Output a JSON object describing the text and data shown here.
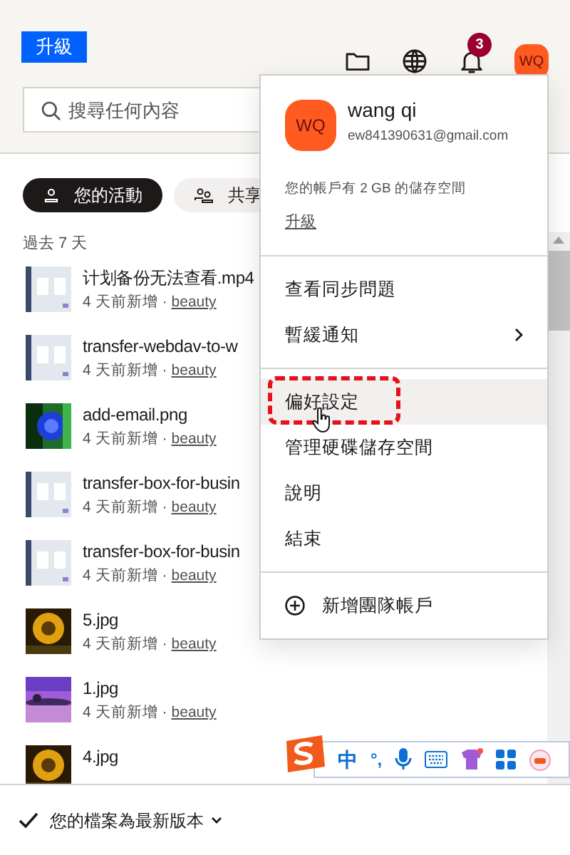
{
  "header": {
    "upgrade_button": "升級",
    "search": {
      "placeholder": "搜尋任何內容"
    },
    "notification_count": "3",
    "avatar": "WQ"
  },
  "filters": [
    {
      "label": "您的活動",
      "selected": true
    },
    {
      "label": "共享",
      "selected": false
    }
  ],
  "section_title": "過去 7 天",
  "files": [
    {
      "name": "计划备份无法查看.mp4",
      "added": "4 天前新增",
      "separator": "·",
      "owner": "beauty"
    },
    {
      "name": "transfer-webdav-to-w",
      "added": "4 天前新增",
      "separator": "·",
      "owner": "beauty"
    },
    {
      "name": "add-email.png",
      "added": "4 天前新增",
      "separator": "·",
      "owner": "beauty"
    },
    {
      "name": "transfer-box-for-busin",
      "added": "4 天前新增",
      "separator": "·",
      "owner": "beauty"
    },
    {
      "name": "transfer-box-for-busin",
      "added": "4 天前新增",
      "separator": "·",
      "owner": "beauty"
    },
    {
      "name": "5.jpg",
      "added": "4 天前新增",
      "separator": "·",
      "owner": "beauty"
    },
    {
      "name": "1.jpg",
      "added": "4 天前新增",
      "separator": "·",
      "owner": "beauty"
    },
    {
      "name": "4.jpg"
    }
  ],
  "footer": {
    "status": "您的檔案為最新版本"
  },
  "account_menu": {
    "avatar": "WQ",
    "name": "wang qi",
    "email": "ew841390631@gmail.com",
    "storage": "您的帳戶有 2 GB 的儲存空間",
    "upgrade_link": "升級",
    "groups": [
      [
        {
          "label": "查看同步問題",
          "kind": "item",
          "hovered": false
        },
        {
          "label": "暫緩通知",
          "kind": "submenu",
          "hovered": false
        }
      ],
      [
        {
          "label": "偏好設定",
          "kind": "item",
          "hovered": true
        },
        {
          "label": "管理硬碟儲存空間",
          "kind": "item",
          "hovered": false
        },
        {
          "label": "說明",
          "kind": "item",
          "hovered": false
        },
        {
          "label": "結束",
          "kind": "item",
          "hovered": false
        }
      ],
      [
        {
          "label": "新增團隊帳戶",
          "kind": "add",
          "hovered": false
        }
      ]
    ]
  },
  "ime_toolbar": {
    "mode": "中",
    "punctuation": "°,"
  }
}
